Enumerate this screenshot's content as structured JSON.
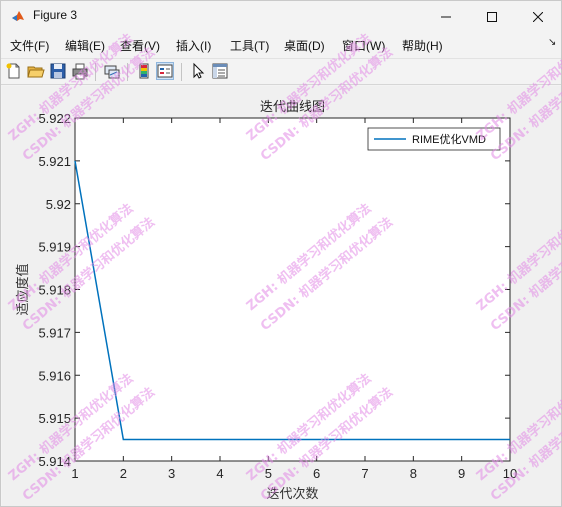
{
  "window": {
    "title": "Figure 3"
  },
  "menu": [
    "文件(F)",
    "编辑(E)",
    "查看(V)",
    "插入(I)",
    "工具(T)",
    "桌面(D)",
    "窗口(W)",
    "帮助(H)"
  ],
  "toolbar": {
    "icons": [
      "new-figure-icon",
      "open-file-icon",
      "save-icon",
      "print-icon",
      "link-plot-icon",
      "insert-colorbar-icon",
      "insert-legend-icon",
      "arrow-pointer-icon",
      "property-inspector-icon"
    ],
    "selected": "insert-legend-icon"
  },
  "watermark": {
    "lines": [
      "ZGH: 机器学习和优化算法",
      "CSDN: 机器学习和优化算法"
    ],
    "color": "#e28be6"
  },
  "chart_data": {
    "type": "line",
    "title": "迭代曲线图",
    "xlabel": "迭代次数",
    "ylabel": "适应度值",
    "xlim": [
      1,
      10
    ],
    "ylim": [
      5.914,
      5.922
    ],
    "xticks": [
      "1",
      "2",
      "3",
      "4",
      "5",
      "6",
      "7",
      "8",
      "9",
      "10"
    ],
    "yticks": [
      "5.914",
      "5.915",
      "5.916",
      "5.917",
      "5.918",
      "5.919",
      "5.92",
      "5.921",
      "5.922"
    ],
    "legend_position": "top-right",
    "grid": false,
    "series": [
      {
        "name": "RIME优化VMD",
        "color": "#0072bd",
        "x": [
          1,
          2,
          3,
          4,
          5,
          6,
          7,
          8,
          9,
          10
        ],
        "y": [
          5.921,
          5.9145,
          5.9145,
          5.9145,
          5.9145,
          5.9145,
          5.9145,
          5.9145,
          5.9145,
          5.9145
        ]
      }
    ]
  }
}
